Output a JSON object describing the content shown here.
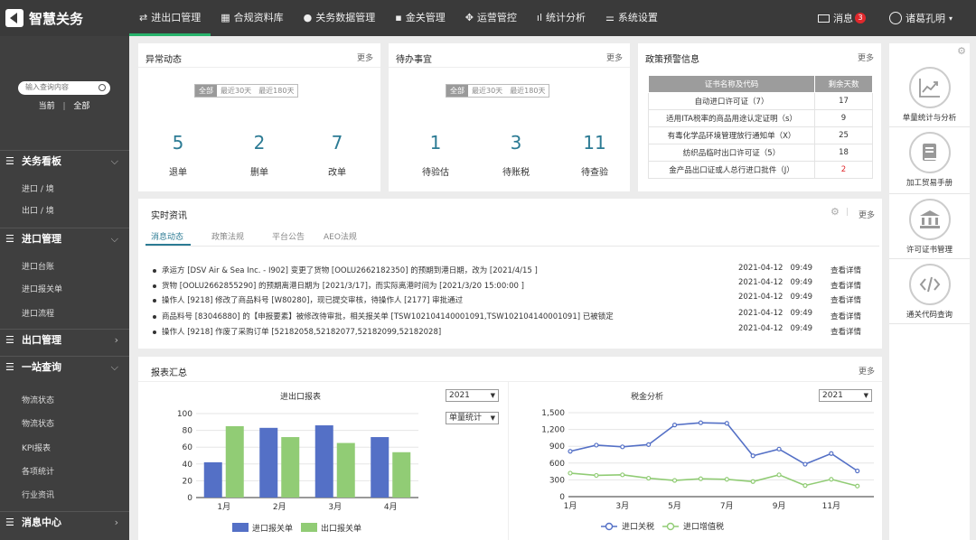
{
  "app": {
    "title": "智慧关务"
  },
  "nav": [
    {
      "label": "进出口管理",
      "icon": "⇄"
    },
    {
      "label": "合规资料库",
      "icon": "▦"
    },
    {
      "label": "关务数据管理",
      "icon": "●"
    },
    {
      "label": "金关管理",
      "icon": "▪"
    },
    {
      "label": "运营管控",
      "icon": "✥"
    },
    {
      "label": "统计分析",
      "icon": "ıl"
    },
    {
      "label": "系统设置",
      "icon": "⚌"
    }
  ],
  "topright": {
    "messages_label": "消息",
    "messages_count": "3",
    "user_name": "诸葛孔明"
  },
  "sidebar": {
    "search_placeholder": "输入查询内容",
    "scope_current": "当前",
    "scope_sep": "|",
    "scope_all": "全部",
    "groups": [
      {
        "label": "关务看板",
        "items": [
          "进口 / 境",
          "出口 / 境"
        ]
      },
      {
        "label": "进口管理",
        "items": [
          "进口台账",
          "进口报关单",
          "进口流程"
        ]
      },
      {
        "label": "出口管理",
        "items": []
      },
      {
        "label": "一站查询",
        "items": [
          "物流状态",
          "物流状态",
          "KPI报表",
          "各项统计",
          "行业资讯"
        ]
      },
      {
        "label": "消息中心",
        "items": []
      }
    ]
  },
  "common": {
    "more": "更多",
    "seg": [
      "全部",
      "最近30天",
      "最近180天"
    ]
  },
  "anomaly": {
    "title": "异常动态",
    "stats": [
      {
        "value": "5",
        "label": "退单"
      },
      {
        "value": "2",
        "label": "删单"
      },
      {
        "value": "7",
        "label": "改单"
      }
    ]
  },
  "todo": {
    "title": "待办事宜",
    "stats": [
      {
        "value": "1",
        "label": "待验估"
      },
      {
        "value": "3",
        "label": "待账税"
      },
      {
        "value": "11",
        "label": "待查验"
      }
    ]
  },
  "policy": {
    "title": "政策预警信息",
    "col1": "证书名称及代码",
    "col2": "剩余天数",
    "rows": [
      {
        "name": "自动进口许可证（7）",
        "days": "17",
        "warn": false
      },
      {
        "name": "适用ITA税率的商品用途认定证明（s）",
        "days": "9",
        "warn": false
      },
      {
        "name": "有毒化学品环境管理放行通知单（X）",
        "days": "25",
        "warn": false
      },
      {
        "name": "纺织品临时出口许可证（5）",
        "days": "18",
        "warn": false
      },
      {
        "name": "金产品出口证或人总行进口批件（J）",
        "days": "2",
        "warn": true
      }
    ]
  },
  "news": {
    "title": "实时资讯",
    "sep": "|",
    "tabs": [
      "消息动态",
      "政策法规",
      "平台公告",
      "AEO法规"
    ],
    "items": [
      {
        "text": "承运方  [DSV Air & Sea Inc. - I902]  变更了货物  [OOLU2662182350]  的预期到港日期，改为  [2021/4/15 ]",
        "date": "2021-04-12",
        "time": "09:49",
        "link": "查看详情"
      },
      {
        "text": "货物  [OOLU2662855290]  的预期离港日期为  [2021/3/17]，而实际离港时间为  [2021/3/20 15:00:00 ]",
        "date": "2021-04-12",
        "time": "09:49",
        "link": "查看详情"
      },
      {
        "text": "操作人  [9218]  修改了商品料号  [W80280]，现已提交审核，待操作人  [2177]  审批通过",
        "date": "2021-04-12",
        "time": "09:49",
        "link": "查看详情"
      },
      {
        "text": "商品料号 [83046880] 的【申报要素】被修改待审批，相关报关单 [TSW102104140001091,TSW102104140001091] 已被锁定",
        "date": "2021-04-12",
        "time": "09:49",
        "link": "查看详情"
      },
      {
        "text": "操作人  [9218]  作废了采购订单  [52182058,52182077,52182099,52182028]",
        "date": "2021-04-12",
        "time": "09:49",
        "link": "查看详情"
      }
    ]
  },
  "report": {
    "title": "报表汇总",
    "bar_title": "进出口报表",
    "bar_year": "2021",
    "bar_mode": "单量统计",
    "line_title": "税金分析",
    "line_year": "2021"
  },
  "rightpanel": [
    {
      "label": "单量统计与分析",
      "icon": "chart-line-icon"
    },
    {
      "label": "加工贸易手册",
      "icon": "book-icon"
    },
    {
      "label": "许可证书管理",
      "icon": "bank-icon"
    },
    {
      "label": "通关代码查询",
      "icon": "code-icon"
    }
  ],
  "chart_data": [
    {
      "type": "bar",
      "title": "进出口报表",
      "categories": [
        "1月",
        "2月",
        "3月",
        "4月"
      ],
      "series": [
        {
          "name": "进口报关单",
          "values": [
            42,
            83,
            86,
            72
          ],
          "color": "#5470c6"
        },
        {
          "name": "出口报关单",
          "values": [
            85,
            72,
            65,
            54
          ],
          "color": "#91cc75"
        }
      ],
      "ylim": [
        0,
        100
      ],
      "yticks": [
        0,
        20,
        40,
        60,
        80,
        100
      ],
      "grid": true,
      "legend": "bottom"
    },
    {
      "type": "line",
      "title": "税金分析",
      "x": [
        "1月",
        "2月",
        "3月",
        "4月",
        "5月",
        "6月",
        "7月",
        "8月",
        "9月",
        "10月",
        "11月",
        "12月"
      ],
      "xticks": [
        "1月",
        "3月",
        "5月",
        "7月",
        "9月",
        "11月"
      ],
      "series": [
        {
          "name": "进口关税",
          "values": [
            810,
            920,
            890,
            930,
            1280,
            1320,
            1310,
            730,
            850,
            580,
            770,
            460
          ],
          "color": "#5470c6"
        },
        {
          "name": "进口增值税",
          "values": [
            420,
            380,
            390,
            330,
            290,
            320,
            310,
            270,
            390,
            200,
            310,
            190
          ],
          "color": "#91cc75"
        }
      ],
      "ylim": [
        0,
        1500
      ],
      "yticks": [
        0,
        300,
        600,
        900,
        1200,
        1500
      ],
      "ytick_labels": [
        "0",
        "300",
        "600",
        "900",
        "1,200",
        "1,500"
      ],
      "grid": true,
      "legend": "bottom"
    }
  ]
}
